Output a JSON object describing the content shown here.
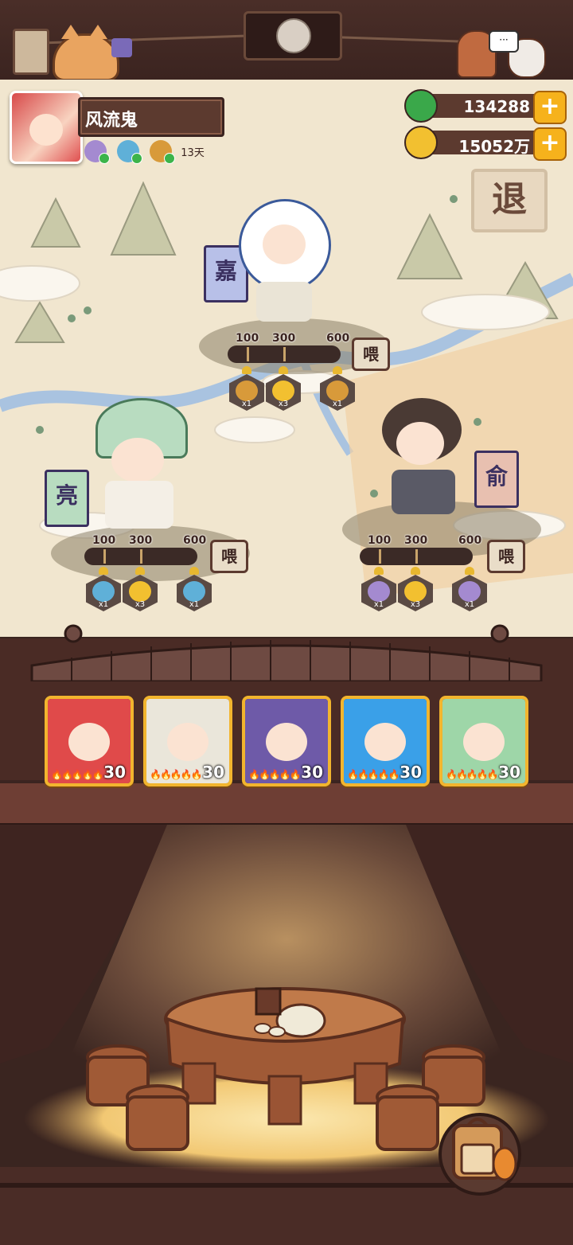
{
  "player": {
    "name": "风流鬼",
    "buff_days": "13天"
  },
  "resources": {
    "jade": "134288",
    "coins": "15052万"
  },
  "map": {
    "retreat_label": "退"
  },
  "stations": [
    {
      "banner": "嘉",
      "thresholds": [
        "100",
        "300",
        "600"
      ],
      "progress": 0.0,
      "feed_label": "喂",
      "rewards": [
        {
          "icon": "key-icon",
          "qty": "x1"
        },
        {
          "icon": "gold-star-icon",
          "qty": "x3"
        },
        {
          "icon": "key-icon",
          "qty": "x1"
        }
      ]
    },
    {
      "banner": "亮",
      "thresholds": [
        "100",
        "300",
        "600"
      ],
      "progress": 0.0,
      "feed_label": "喂",
      "rewards": [
        {
          "icon": "bowl-icon",
          "qty": "x1"
        },
        {
          "icon": "gold-star-icon",
          "qty": "x3"
        },
        {
          "icon": "bowl-icon",
          "qty": "x1"
        }
      ]
    },
    {
      "banner": "俞",
      "thresholds": [
        "100",
        "300",
        "600"
      ],
      "progress": 0.0,
      "feed_label": "喂",
      "rewards": [
        {
          "icon": "portrait-token-icon",
          "qty": "x1"
        },
        {
          "icon": "gold-star-icon",
          "qty": "x3"
        },
        {
          "icon": "portrait-token-icon",
          "qty": "x1"
        }
      ]
    }
  ],
  "heroes": [
    {
      "level": "30",
      "color": "#e04a4a"
    },
    {
      "level": "30",
      "color": "#eae6da"
    },
    {
      "level": "30",
      "color": "#6e5aa8"
    },
    {
      "level": "30",
      "color": "#3aa0e8"
    },
    {
      "level": "30",
      "color": "#9ed6a8"
    }
  ],
  "colors": {
    "wood_dark": "#3b2420",
    "accent_gold": "#f6b21c",
    "map_bg": "#f1e6cf"
  }
}
